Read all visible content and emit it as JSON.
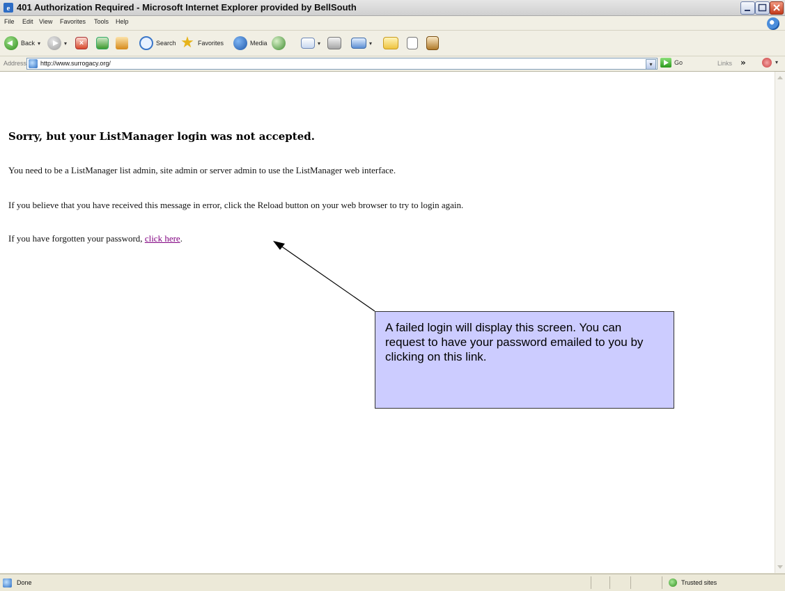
{
  "window": {
    "title": "401 Authorization Required - Microsoft Internet Explorer provided by BellSouth"
  },
  "menu": {
    "items": [
      "File",
      "Edit",
      "View",
      "Favorites",
      "Tools",
      "Help"
    ]
  },
  "toolbar": {
    "back_label": "Back",
    "search_label": "Search",
    "favorites_label": "Favorites",
    "media_label": "Media"
  },
  "address": {
    "label": "Address",
    "url": "http://www.surrogacy.org/",
    "go_label": "Go",
    "links_label": "Links"
  },
  "page": {
    "heading": "Sorry, but your ListManager login was not accepted.",
    "para1": "You need to be a ListManager list admin, site admin or server admin to use the ListManager web interface.",
    "para2": "If you believe that you have received this message in error, click the Reload button on your web browser to try to login again.",
    "para3_prefix": "If you have forgotten your password, ",
    "para3_link": "click here",
    "para3_suffix": "."
  },
  "annotation": {
    "text": "A failed login will display this screen. You can request to have your password emailed to you by clicking on this link."
  },
  "status": {
    "left": "Done",
    "zone": "Trusted sites"
  },
  "colors": {
    "callout_fill": "#ccccff",
    "visited_link": "#800080"
  }
}
